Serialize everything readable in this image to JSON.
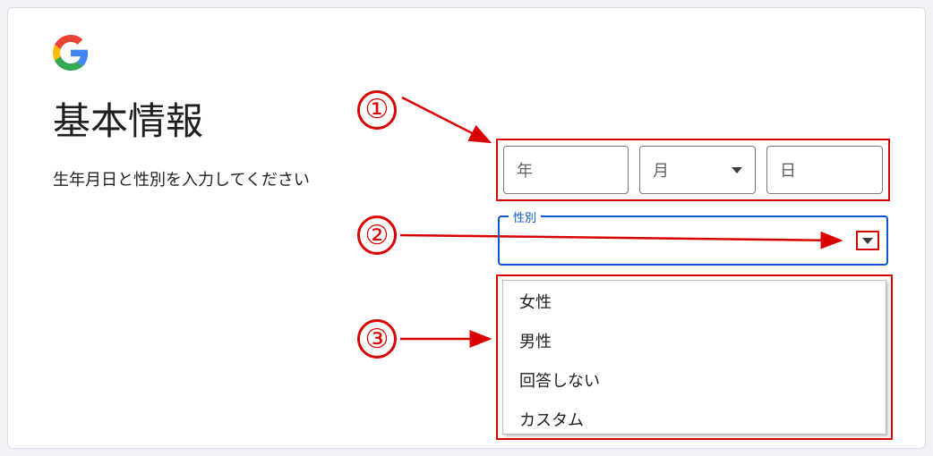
{
  "heading": "基本情報",
  "subtext": "生年月日と性別を入力してください",
  "dob": {
    "year_label": "年",
    "month_label": "月",
    "day_label": "日"
  },
  "gender": {
    "legend": "性別",
    "options": [
      "女性",
      "男性",
      "回答しない",
      "カスタム"
    ]
  },
  "callouts": {
    "c1": "①",
    "c2": "②",
    "c3": "③"
  }
}
